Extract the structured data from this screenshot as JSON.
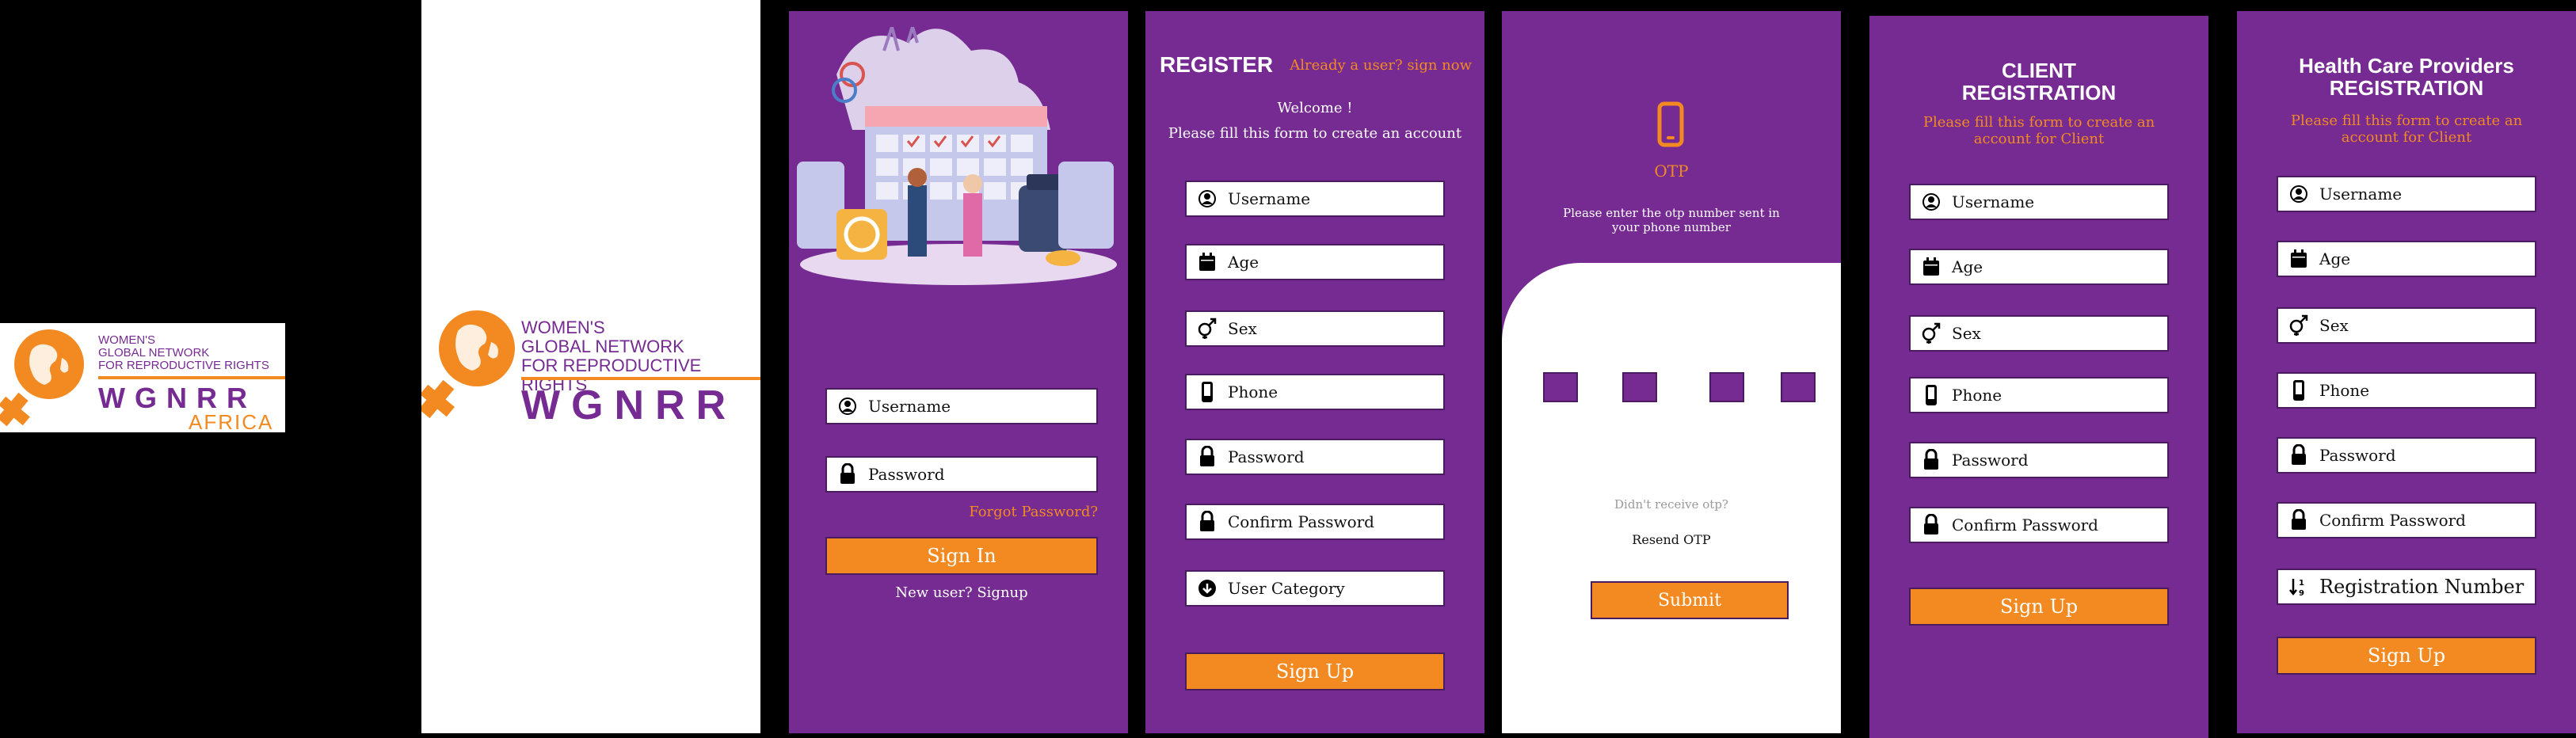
{
  "colors": {
    "purple": "#752b91",
    "orange": "#f28a21",
    "white": "#ffffff",
    "black": "#000000"
  },
  "logo_africa": {
    "line1": "WOMEN'S",
    "line2": "GLOBAL NETWORK",
    "line3": "FOR REPRODUCTIVE RIGHTS",
    "acronym": "WGNRR",
    "region": "AFRICA"
  },
  "logo_main": {
    "line1": "WOMEN'S",
    "line2": "GLOBAL NETWORK",
    "line3": "FOR REPRODUCTIVE RIGHTS",
    "acronym": "WGNRR"
  },
  "login": {
    "username_label": "Username",
    "username_icon": "user-circle-icon",
    "password_label": "Password",
    "password_icon": "lock-icon",
    "forgot": "Forgot Password?",
    "signin": "Sign In",
    "new_user": "New user? Signup"
  },
  "register": {
    "title": "REGISTER",
    "already": "Already a user? sign now",
    "welcome": "Welcome !",
    "instructions": "Please fill this form to create an account",
    "fields": [
      {
        "label": "Username",
        "icon": "user-circle-icon"
      },
      {
        "label": "Age",
        "icon": "calendar-icon"
      },
      {
        "label": "Sex",
        "icon": "gender-icon"
      },
      {
        "label": "Phone",
        "icon": "phone-icon"
      },
      {
        "label": "Password",
        "icon": "lock-icon"
      },
      {
        "label": "Confirm Password",
        "icon": "lock-icon"
      },
      {
        "label": "User Category",
        "icon": "arrow-down-circle-icon"
      }
    ],
    "signup": "Sign Up"
  },
  "otp": {
    "title": "OTP",
    "icon": "phone-icon",
    "instructions": "Please enter the otp number sent in your phone number",
    "didnt_receive": "Didn't receive otp?",
    "resend": "Resend OTP",
    "submit": "Submit"
  },
  "client": {
    "title_line1": "CLIENT",
    "title_line2": "REGISTRATION",
    "subtitle": "Please fill this form to create an account for Client",
    "fields": [
      {
        "label": "Username",
        "icon": "user-circle-icon"
      },
      {
        "label": "Age",
        "icon": "calendar-icon"
      },
      {
        "label": "Sex",
        "icon": "gender-icon"
      },
      {
        "label": "Phone",
        "icon": "phone-icon"
      },
      {
        "label": "Password",
        "icon": "lock-icon"
      },
      {
        "label": "Confirm Password",
        "icon": "lock-icon"
      }
    ],
    "signup": "Sign Up"
  },
  "provider": {
    "title_line1": "Health Care Providers",
    "title_line2": "REGISTRATION",
    "subtitle": "Please fill this form to create an account for Client",
    "fields": [
      {
        "label": "Username",
        "icon": "user-circle-icon"
      },
      {
        "label": "Age",
        "icon": "calendar-icon"
      },
      {
        "label": "Sex",
        "icon": "gender-icon"
      },
      {
        "label": "Phone",
        "icon": "phone-icon"
      },
      {
        "label": "Password",
        "icon": "lock-icon"
      },
      {
        "label": "Confirm Password",
        "icon": "lock-icon"
      },
      {
        "label": "Registration Number",
        "icon": "sort-numeric-icon"
      }
    ],
    "signup": "Sign Up"
  }
}
